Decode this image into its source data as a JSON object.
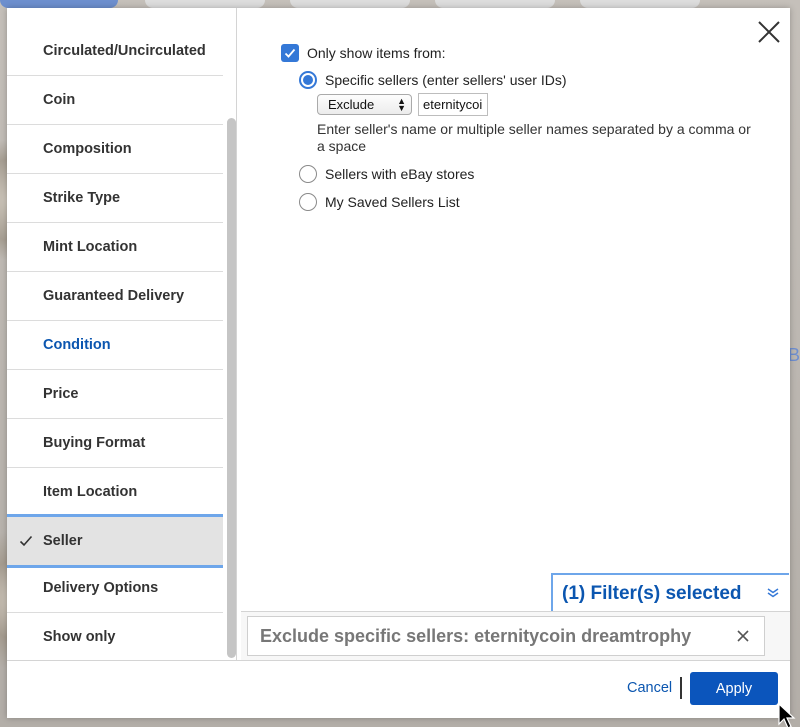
{
  "sidebar": {
    "items": [
      {
        "label": "Circulated/Uncirculated"
      },
      {
        "label": "Coin"
      },
      {
        "label": "Composition"
      },
      {
        "label": "Strike Type"
      },
      {
        "label": "Mint Location"
      },
      {
        "label": "Guaranteed Delivery"
      },
      {
        "label": "Condition"
      },
      {
        "label": "Price"
      },
      {
        "label": "Buying Format"
      },
      {
        "label": "Item Location"
      },
      {
        "label": "Seller"
      },
      {
        "label": "Delivery Options"
      },
      {
        "label": "Show only"
      }
    ],
    "selected": "Seller",
    "link_item": "Condition"
  },
  "seller_panel": {
    "only_show_label": "Only show items from:",
    "only_show_checked": true,
    "options": {
      "specific": "Specific sellers (enter sellers' user IDs)",
      "stores": "Sellers with eBay stores",
      "saved": "My Saved Sellers List"
    },
    "selected_option": "specific",
    "mode_select": {
      "value": "Exclude"
    },
    "seller_input": {
      "value": "eternitycoin dreamtrophy"
    },
    "help_text": "Enter seller's name or multiple seller names separated by a comma or a space"
  },
  "filters": {
    "summary_label": "(1) Filter(s) selected",
    "chip_text": "Exclude specific sellers: eternitycoin dreamtrophy"
  },
  "footer": {
    "cancel_label": "Cancel",
    "apply_label": "Apply"
  },
  "backdrop": {
    "edge_char": "B"
  },
  "colors": {
    "accent": "#3478d7",
    "link": "#0b56b0",
    "apply_bg": "#0b55bc",
    "selected_border": "#6ea6ea"
  }
}
